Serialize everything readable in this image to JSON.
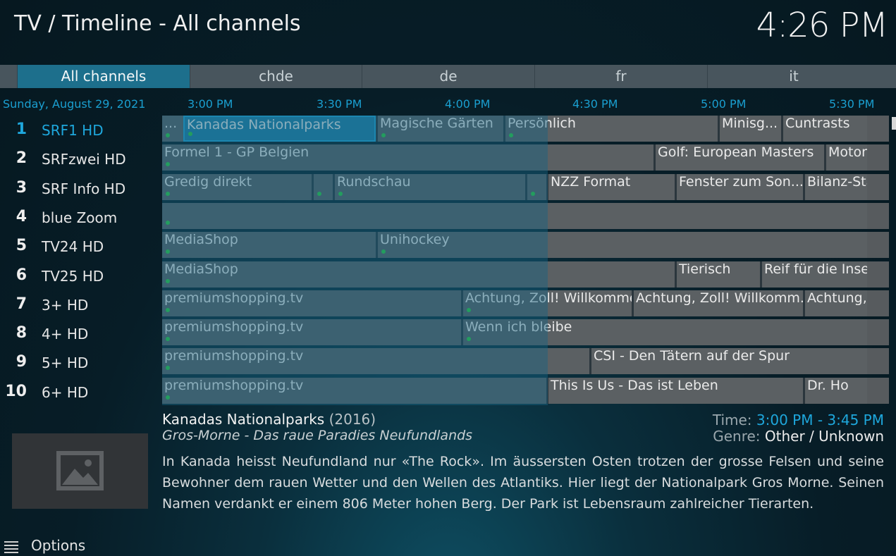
{
  "header": {
    "title": "TV / Timeline - All channels",
    "clock": "4:26 PM"
  },
  "tabs": [
    {
      "label": "All channels",
      "active": true
    },
    {
      "label": "chde",
      "active": false
    },
    {
      "label": "de",
      "active": false
    },
    {
      "label": "fr",
      "active": false
    },
    {
      "label": "it",
      "active": false
    }
  ],
  "timeline": {
    "date": "Sunday, August 29, 2021",
    "ticks": [
      "3:00 PM",
      "3:30 PM",
      "4:00 PM",
      "4:30 PM",
      "5:00 PM",
      "5:30 PM"
    ]
  },
  "channels": [
    {
      "number": "1",
      "name": "SRF1 HD",
      "selected": true
    },
    {
      "number": "2",
      "name": "SRFzwei HD"
    },
    {
      "number": "3",
      "name": "SRF Info HD"
    },
    {
      "number": "4",
      "name": "blue Zoom"
    },
    {
      "number": "5",
      "name": "TV24 HD"
    },
    {
      "number": "6",
      "name": "TV25 HD"
    },
    {
      "number": "7",
      "name": "3+ HD"
    },
    {
      "number": "8",
      "name": "4+ HD"
    },
    {
      "number": "9",
      "name": "5+ HD"
    },
    {
      "number": "10",
      "name": "6+ HD"
    }
  ],
  "programmes": [
    [
      {
        "title": "...",
        "start": "2:55 PM",
        "end": "3:00 PM",
        "dot": true
      },
      {
        "title": "Kanadas Nationalparks",
        "start": "3:00 PM",
        "end": "3:45 PM",
        "dot": true,
        "focused": true
      },
      {
        "title": "Magische Gärten",
        "start": "3:45 PM",
        "end": "4:15 PM",
        "dot": true
      },
      {
        "title": "Persönlich",
        "start": "4:15 PM",
        "end": "5:05 PM",
        "dot": true
      },
      {
        "title": "Minisg...",
        "start": "5:05 PM",
        "end": "5:20 PM"
      },
      {
        "title": "Cuntrasts",
        "start": "5:20 PM",
        "end": "5:40 PM"
      }
    ],
    [
      {
        "title": "Formel 1 - GP Belgien",
        "start": "2:55 PM",
        "end": "4:50 PM",
        "dot": true
      },
      {
        "title": "Golf: European Masters",
        "start": "4:50 PM",
        "end": "5:30 PM"
      },
      {
        "title": "Motorrad",
        "start": "5:30 PM",
        "end": "5:40 PM"
      }
    ],
    [
      {
        "title": "Gredig direkt",
        "start": "2:55 PM",
        "end": "3:30 PM",
        "dot": true
      },
      {
        "title": "",
        "start": "3:30 PM",
        "end": "3:35 PM",
        "dot": true
      },
      {
        "title": "Rundschau",
        "start": "3:35 PM",
        "end": "4:20 PM",
        "dot": true
      },
      {
        "title": "",
        "start": "4:20 PM",
        "end": "4:25 PM",
        "dot": true
      },
      {
        "title": "NZZ Format",
        "start": "4:25 PM",
        "end": "4:55 PM"
      },
      {
        "title": "Fenster zum Son...",
        "start": "4:55 PM",
        "end": "5:25 PM"
      },
      {
        "title": "Bilanz-Sta",
        "start": "5:25 PM",
        "end": "5:40 PM"
      }
    ],
    [
      {
        "title": "",
        "start": "2:55 PM",
        "end": "5:40 PM",
        "dot": true
      }
    ],
    [
      {
        "title": "MediaShop",
        "start": "2:55 PM",
        "end": "3:45 PM",
        "dot": true
      },
      {
        "title": "Unihockey",
        "start": "3:45 PM",
        "end": "5:40 PM",
        "dot": true
      }
    ],
    [
      {
        "title": "MediaShop",
        "start": "2:55 PM",
        "end": "4:55 PM",
        "dot": true
      },
      {
        "title": "Tierisch",
        "start": "4:55 PM",
        "end": "5:15 PM"
      },
      {
        "title": "Reif für die Insel",
        "start": "5:15 PM",
        "end": "5:40 PM"
      }
    ],
    [
      {
        "title": "premiumshopping.tv",
        "start": "2:55 PM",
        "end": "4:05 PM",
        "dot": true
      },
      {
        "title": "Achtung, Zoll! Willkommen ...",
        "start": "4:05 PM",
        "end": "4:45 PM",
        "dot": true
      },
      {
        "title": "Achtung, Zoll! Willkomm...",
        "start": "4:45 PM",
        "end": "5:25 PM"
      },
      {
        "title": "Achtung, ",
        "start": "5:25 PM",
        "end": "5:40 PM"
      }
    ],
    [
      {
        "title": "premiumshopping.tv",
        "start": "2:55 PM",
        "end": "4:05 PM",
        "dot": true
      },
      {
        "title": "Wenn ich bleibe",
        "start": "4:05 PM",
        "end": "5:40 PM",
        "dot": true
      }
    ],
    [
      {
        "title": "premiumshopping.tv",
        "start": "2:55 PM",
        "end": "4:35 PM",
        "dot": true
      },
      {
        "title": "CSI - Den Tätern auf der Spur",
        "start": "4:35 PM",
        "end": "5:40 PM"
      }
    ],
    [
      {
        "title": "premiumshopping.tv",
        "start": "2:55 PM",
        "end": "4:25 PM",
        "dot": true
      },
      {
        "title": "This Is Us - Das ist Leben",
        "start": "4:25 PM",
        "end": "5:25 PM"
      },
      {
        "title": "Dr. Ho",
        "start": "5:25 PM",
        "end": "5:40 PM"
      }
    ]
  ],
  "details": {
    "title": "Kanadas Nationalparks",
    "year": "(2016)",
    "episode": "Gros-Morne - Das raue Paradies Neufundlands",
    "time_label": "Time:",
    "time_value": "3:00 PM - 3:45 PM",
    "genre_label": "Genre:",
    "genre_value": "Other / Unknown",
    "plot": "In Kanada heisst Neufundland nur «The Rock». Im äussersten Osten trotzen der grosse Felsen und seine Bewohner dem rauen Wetter und den Wellen des Atlantiks. Hier liegt der Nationalpark Gros Morne. Seinen Namen verdankt er einem 806 Meter hohen Berg. Der Park ist Lebensraum zahlreicher Tierarten.",
    "thumbnail_icon": "image-placeholder-icon"
  },
  "footer": {
    "options_label": "Options",
    "options_icon": "menu-icon"
  },
  "colors": {
    "accent": "#1ea7dc",
    "focus": "#1f7fa6",
    "dot": "#2ecc40"
  }
}
